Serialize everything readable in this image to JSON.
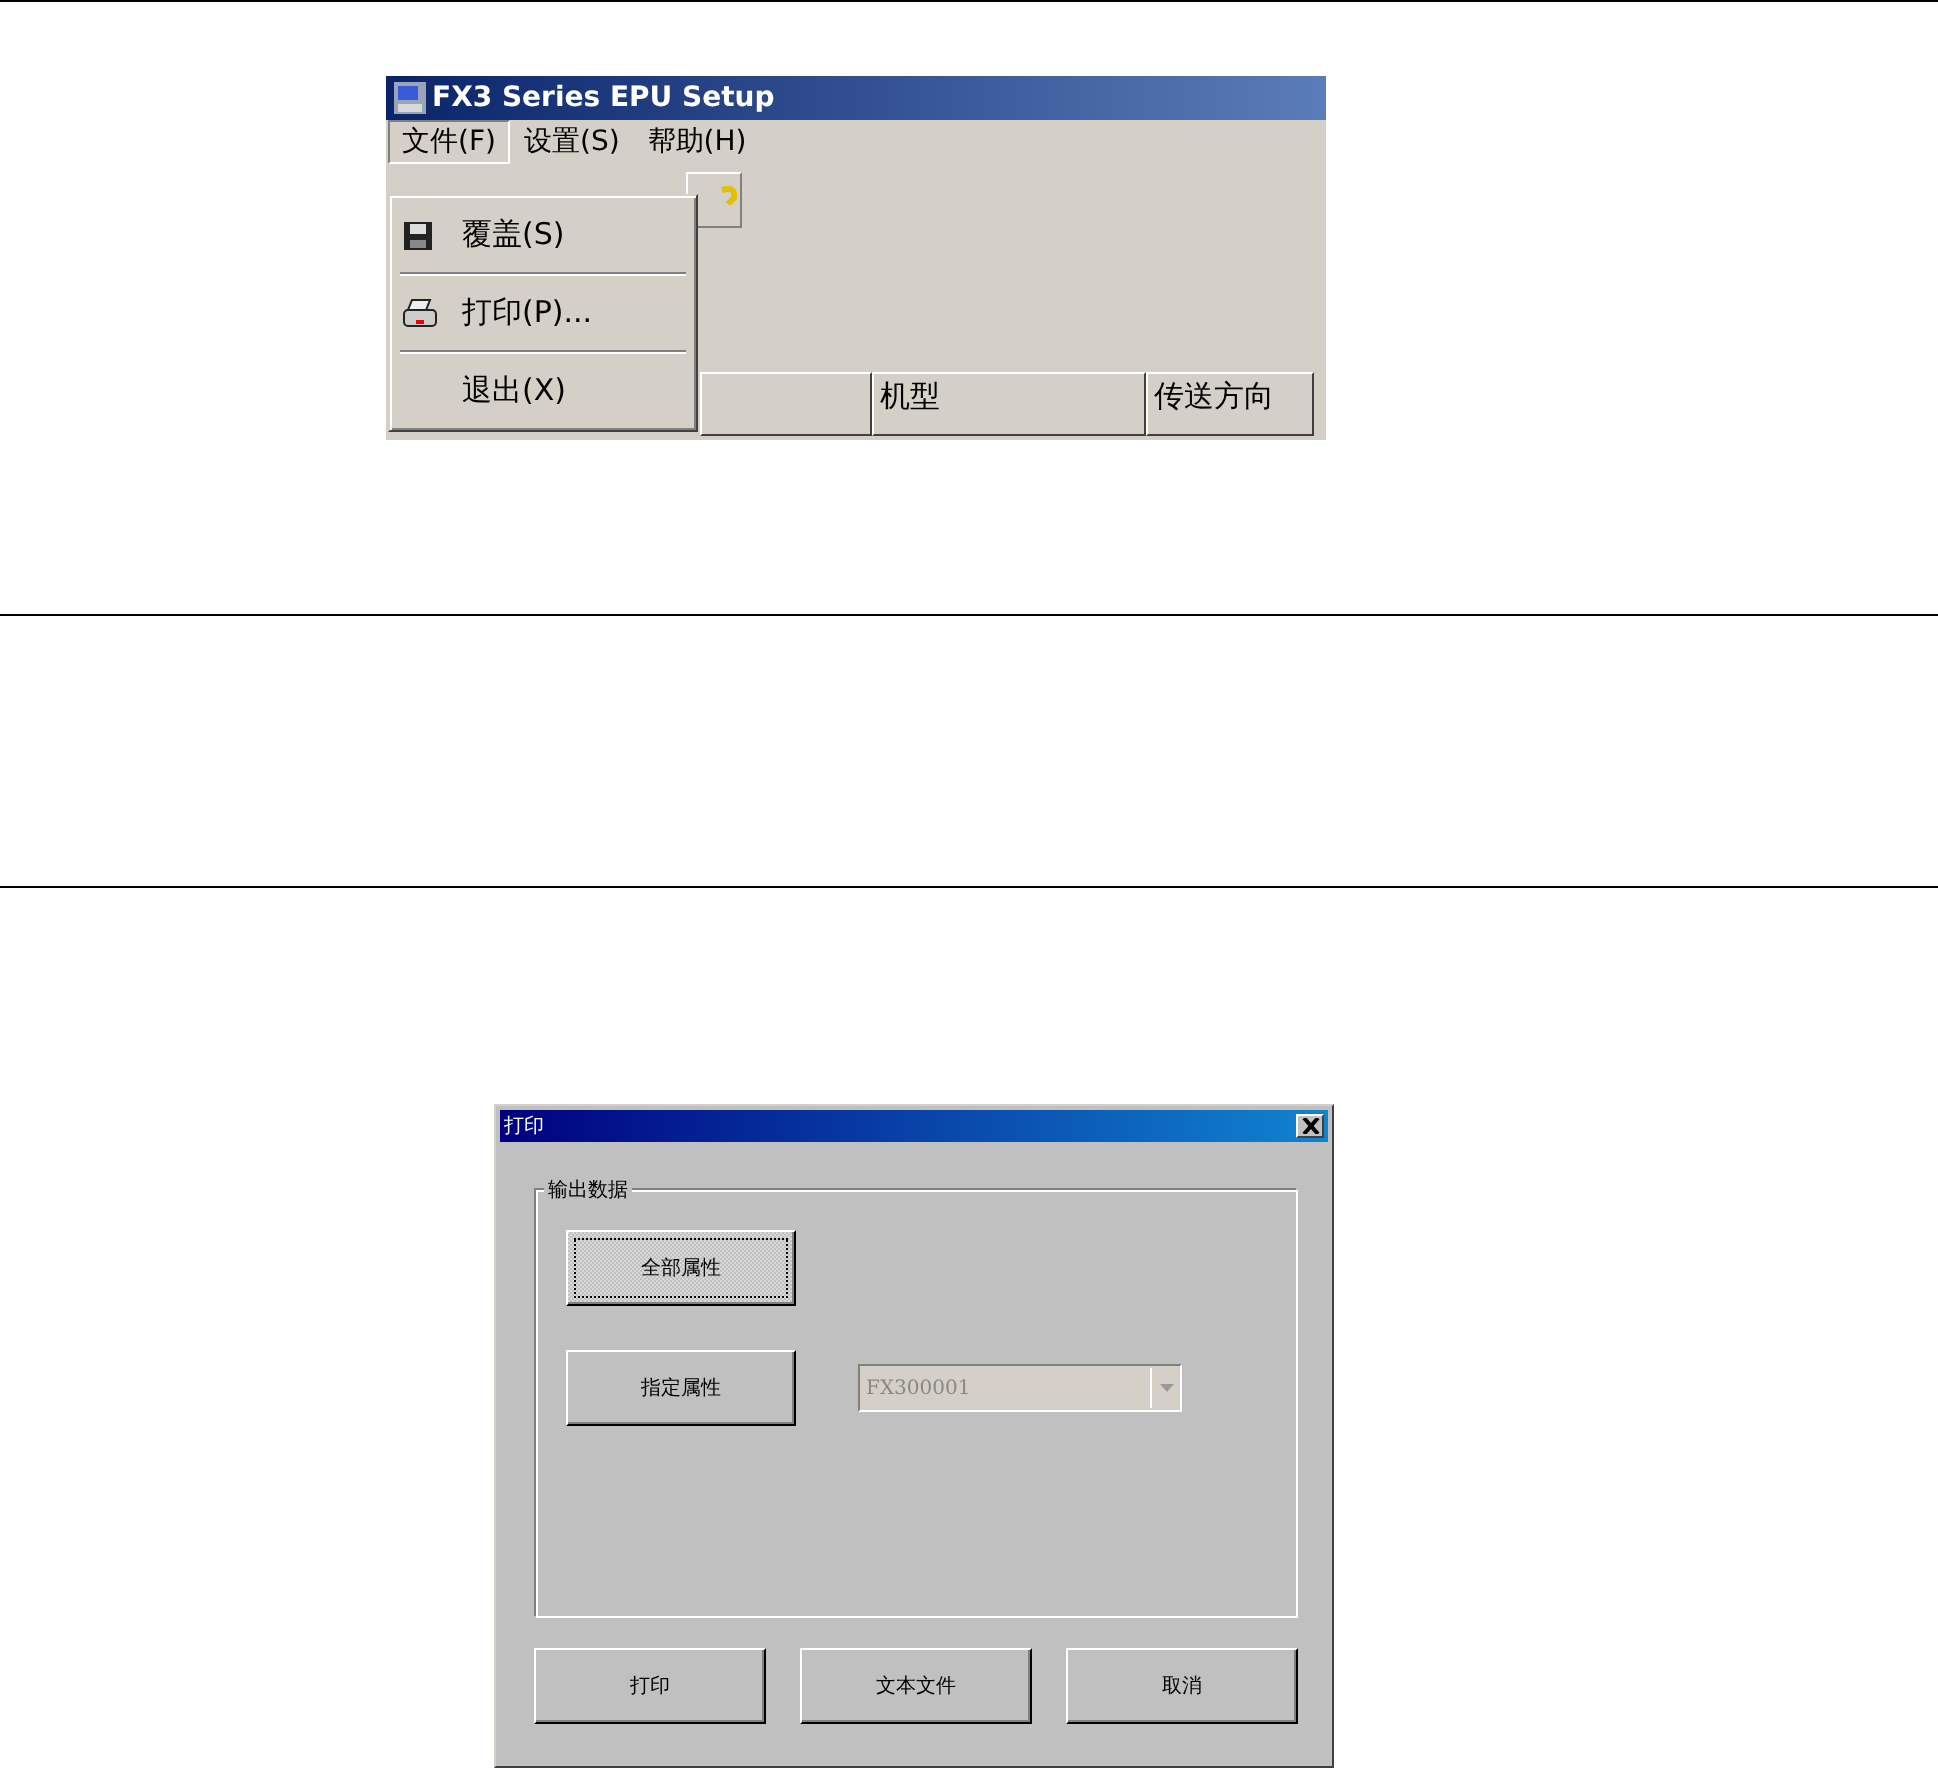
{
  "app_window": {
    "title": "FX3 Series EPU Setup",
    "menu_bar": [
      {
        "label": "文件(F)",
        "selected": true
      },
      {
        "label": "设置(S)",
        "selected": false
      },
      {
        "label": "帮助(H)",
        "selected": false
      }
    ],
    "file_menu": [
      {
        "kind": "disk",
        "label": "覆盖(S)"
      },
      {
        "kind": "printer",
        "label": "打印(P)..."
      },
      {
        "kind": "plain",
        "label": "退出(X)"
      }
    ],
    "table_columns": [
      "机型",
      "传送方向"
    ]
  },
  "print_dialog": {
    "title": "打印",
    "group_label": "输出数据",
    "option_buttons": [
      {
        "label": "全部属性",
        "focused": true
      },
      {
        "label": "指定属性",
        "focused": false
      }
    ],
    "model_combo": {
      "value": "FX300001",
      "disabled": true
    },
    "buttons": [
      "打印",
      "文本文件",
      "取消"
    ]
  }
}
